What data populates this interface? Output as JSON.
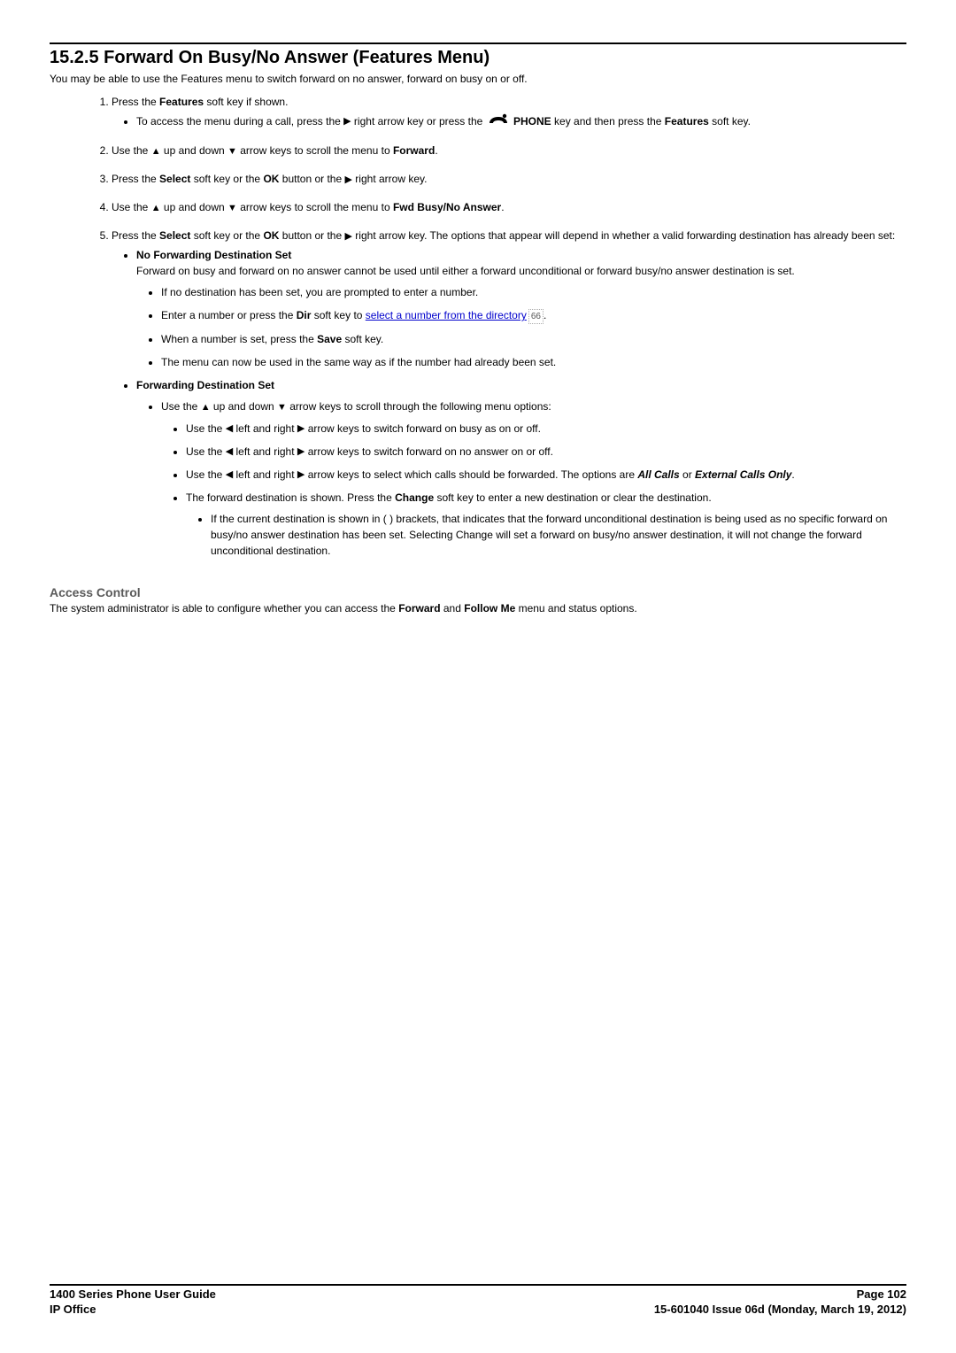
{
  "heading": "15.2.5 Forward On Busy/No Answer (Features Menu)",
  "intro": "You may be able to use the Features menu to switch forward on no answer, forward on busy on or off.",
  "steps": {
    "s1": "Press the ",
    "s1b": "Features",
    "s1c": " soft key if shown.",
    "s1_sub_a": "To access the menu during a call, press the ",
    "s1_sub_b": " right arrow key or press the ",
    "s1_sub_c": "PHONE",
    "s1_sub_d": " key and then press the ",
    "s1_sub_e": "Features",
    "s1_sub_f": " soft key.",
    "s2a": "Use the ",
    "s2b": " up and down ",
    "s2c": " arrow keys to scroll the menu to ",
    "s2d": "Forward",
    "s2e": ".",
    "s3a": "Press the ",
    "s3b": "Select",
    "s3c": " soft key or the ",
    "s3d": "OK",
    "s3e": " button or the ",
    "s3f": " right arrow key.",
    "s4a": "Use the ",
    "s4b": " up and down ",
    "s4c": " arrow keys to scroll the menu to ",
    "s4d": "Fwd Busy/No Answer",
    "s4e": ".",
    "s5a": "Press the ",
    "s5b": "Select",
    "s5c": " soft key or the ",
    "s5d": "OK",
    "s5e": " button or the ",
    "s5f": " right arrow key. The options that appear will depend in whether a valid forwarding destination has already been set:",
    "nfd_title": "No Forwarding Destination Set",
    "nfd_body": "Forward on busy and forward on no answer cannot be used until either a forward unconditional or forward busy/no answer destination is set.",
    "nfd_b1": "If no destination has been set, you are prompted to enter a number.",
    "nfd_b2a": "Enter a number or press the ",
    "nfd_b2b": "Dir",
    "nfd_b2c": " soft key to ",
    "nfd_link": "select a number from the directory",
    "nfd_ref": "66",
    "nfd_b2d": ".",
    "nfd_b3a": "When a number is set, press the ",
    "nfd_b3b": "Save",
    "nfd_b3c": " soft key.",
    "nfd_b4": "The menu can now be used in the same way as if the number had already been set.",
    "fds_title": "Forwarding Destination Set",
    "fds_b1a": "Use the ",
    "fds_b1b": " up and down ",
    "fds_b1c": " arrow keys to scroll through the following menu options:",
    "fds_s1a": "Use the ",
    "fds_s1b": " left and right ",
    "fds_s1c": " arrow keys to switch forward on busy as on or off.",
    "fds_s2a": "Use the ",
    "fds_s2b": " left and right ",
    "fds_s2c": " arrow keys to switch forward on no answer on or off.",
    "fds_s3a": "Use the ",
    "fds_s3b": " left and right ",
    "fds_s3c": " arrow keys to select which calls should be forwarded. The options are ",
    "fds_s3d": "All Calls",
    "fds_s3e": " or ",
    "fds_s3f": "External Calls Only",
    "fds_s3g": ".",
    "fds_s4a": "The forward destination is shown. Press the ",
    "fds_s4b": "Change",
    "fds_s4c": " soft key to enter a new destination or clear the destination.",
    "fds_s4_sub": "If the current destination is shown in ( ) brackets, that indicates that the forward unconditional destination is being used as no specific forward on busy/no answer destination has been set. Selecting Change will set a forward on busy/no answer destination, it will not change the forward unconditional destination.",
    "access_heading": "Access Control",
    "access_body_a": "The system administrator is able to configure whether you can access the ",
    "access_body_b": "Forward",
    "access_body_c": " and ",
    "access_body_d": "Follow Me",
    "access_body_e": " menu and status options.",
    "footer": {
      "left1": "1400 Series Phone User Guide",
      "left2": "IP Office",
      "right1": "Page 102",
      "right2": "15-601040 Issue 06d (Monday, March 19, 2012)"
    }
  }
}
